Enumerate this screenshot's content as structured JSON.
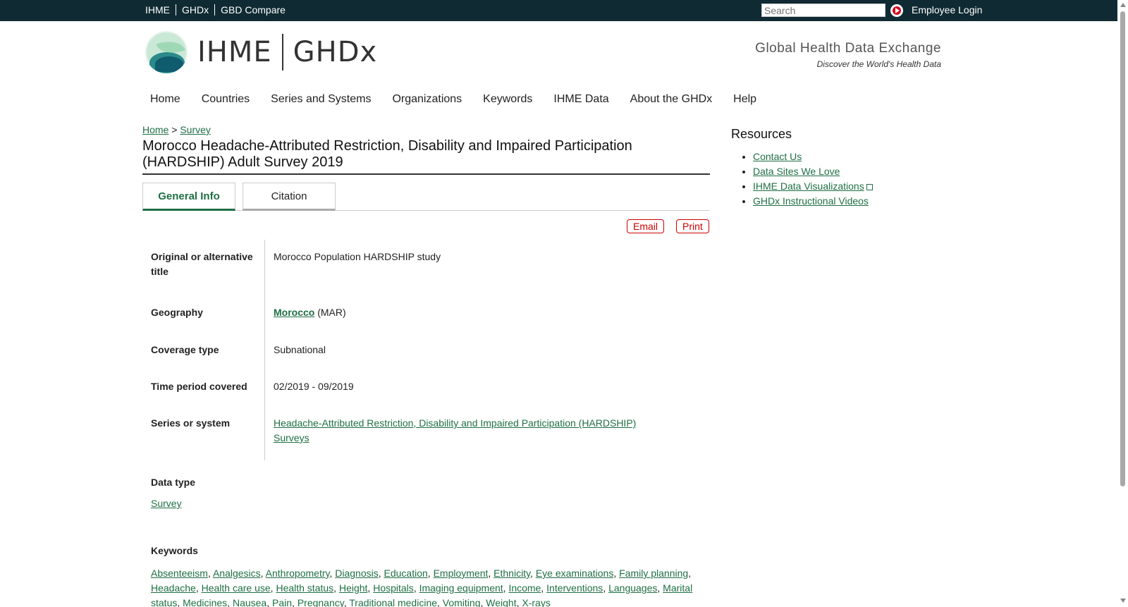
{
  "topbar": {
    "links": [
      "IHME",
      "GHDx",
      "GBD Compare"
    ],
    "search_placeholder": "Search",
    "login": "Employee Login"
  },
  "header": {
    "logo_ihme": "IHME",
    "logo_ghdx": "GHDx",
    "tagline_title": "Global Health Data Exchange",
    "tagline_sub": "Discover the World's Health Data"
  },
  "nav": [
    "Home",
    "Countries",
    "Series and Systems",
    "Organizations",
    "Keywords",
    "IHME Data",
    "About the GHDx",
    "Help"
  ],
  "breadcrumb": {
    "home": "Home",
    "sep": ">",
    "current": "Survey"
  },
  "title": "Morocco Headache-Attributed Restriction, Disability and Impaired Participation (HARDSHIP) Adult Survey 2019",
  "tabs": {
    "general": "General Info",
    "citation": "Citation"
  },
  "actions": {
    "email": "Email",
    "print": "Print"
  },
  "fields": {
    "alt_title_label": "Original or alternative title",
    "alt_title_value": "Morocco Population HARDSHIP study",
    "geography_label": "Geography",
    "geography_link": "Morocco",
    "geography_code": "(MAR)",
    "coverage_label": "Coverage type",
    "coverage_value": "Subnational",
    "time_label": "Time period covered",
    "time_value": "02/2019 - 09/2019",
    "series_label": "Series or system",
    "series_link": "Headache-Attributed Restriction, Disability and Impaired Participation (HARDSHIP) Surveys"
  },
  "data_type": {
    "label": "Data type",
    "value": "Survey"
  },
  "keywords": {
    "label": "Keywords",
    "items": [
      "Absenteeism",
      "Analgesics",
      "Anthropometry",
      "Diagnosis",
      "Education",
      "Employment",
      "Ethnicity",
      "Eye examinations",
      "Family planning",
      "Headache",
      "Health care use",
      "Health status",
      "Height",
      "Hospitals",
      "Imaging equipment",
      "Income",
      "Interventions",
      "Languages",
      "Marital status",
      "Medicines",
      "Nausea",
      "Pain",
      "Pregnancy",
      "Traditional medicine",
      "Vomiting",
      "Weight",
      "X-rays"
    ]
  },
  "resources": {
    "title": "Resources",
    "items": [
      "Contact Us",
      "Data Sites We Love",
      "IHME Data Visualizations",
      "GHDx Instructional Videos"
    ]
  }
}
